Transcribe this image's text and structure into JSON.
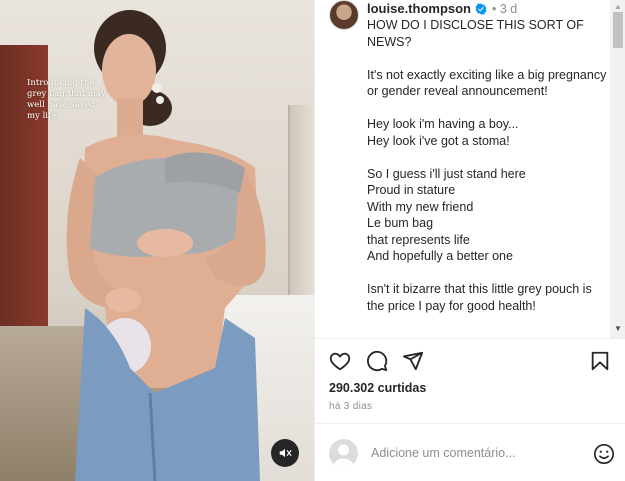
{
  "media": {
    "overlay_text": "Introducing the grey bag that may well have saved my life."
  },
  "post": {
    "username": "louise.thompson",
    "time_ago": "3 d",
    "caption_lines": [
      "HOW DO I DISCLOSE THIS SORT OF NEWS?",
      "",
      "It's not exactly exciting like a big pregnancy or gender reveal announcement!",
      "",
      "Hey look i'm having a boy...",
      "Hey look i've got a stoma!",
      "",
      "So I guess i'll just stand here",
      "Proud in stature",
      "With my new friend",
      "Le bum bag",
      "that represents life",
      "And hopefully a better one",
      "",
      "Isn't it bizarre that this little grey pouch is the price I pay for good health!"
    ],
    "likes": "290.302 curtidas",
    "date": "há 3 dias"
  },
  "comment": {
    "placeholder": "Adicione um comentário..."
  },
  "icons": {
    "like": "heart-icon",
    "comment": "comment-icon",
    "share": "share-icon",
    "save": "bookmark-icon",
    "emoji": "emoji-icon",
    "mute": "sound-off-icon",
    "verified": "verified-badge-icon"
  },
  "colors": {
    "verified": "#0095f6",
    "text": "#262626",
    "muted": "#8e8e8e"
  }
}
